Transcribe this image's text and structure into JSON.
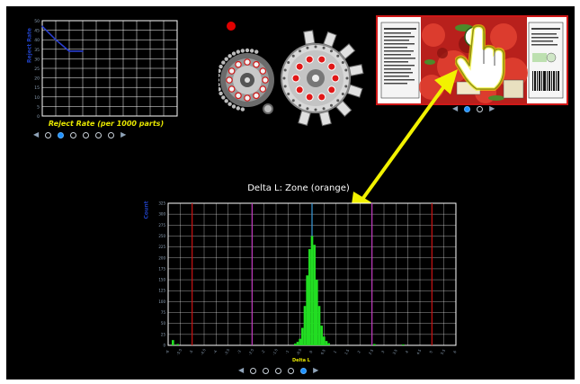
{
  "reject_panel": {
    "ylabel": "Reject Rate",
    "xlabel": "Reject Rate (per 1000 parts)",
    "pager": {
      "count": 6,
      "active": 1
    }
  },
  "label_panel": {
    "pager": {
      "count": 2,
      "active": 0
    }
  },
  "histogram_panel": {
    "title": "Delta L: Zone (orange)",
    "ylabel": "Count",
    "xlabel": "Delta L",
    "pager": {
      "count": 5,
      "active": 4
    }
  },
  "colors": {
    "background": "#000000",
    "grid": "#ffffff",
    "histogram": "#22dd22",
    "arrow": "#f2f200",
    "axis_label": "#1f3fbf",
    "pager_active": "#1e90ff",
    "red_marker": "#e00000"
  },
  "icons": [
    "status-light-icon",
    "rotary-machine-icon",
    "hand-cursor-icon",
    "double-arrow-icon"
  ],
  "chart_data": [
    {
      "type": "line",
      "title": "",
      "xlabel": "Reject Rate (per 1000 parts)",
      "ylabel": "Reject Rate",
      "ylim": [
        0,
        50
      ],
      "yticks": [
        0,
        5,
        10,
        15,
        20,
        25,
        30,
        35,
        40,
        45,
        50
      ],
      "x": [
        0,
        1,
        2,
        3
      ],
      "xlim": [
        0,
        10
      ],
      "series": [
        {
          "values": [
            47,
            40,
            34,
            34
          ]
        }
      ],
      "grid": true
    },
    {
      "type": "bar",
      "title": "Delta L: Zone (orange)",
      "xlabel": "Delta L",
      "ylabel": "Count",
      "ylim": [
        0,
        325
      ],
      "yticks": [
        0,
        25,
        50,
        75,
        100,
        125,
        150,
        175,
        200,
        225,
        250,
        275,
        300,
        325
      ],
      "xlim": [
        -6,
        6
      ],
      "xticks": [
        -6,
        -5.5,
        -5,
        -4.5,
        -4,
        -3.5,
        -3,
        -2.5,
        -2,
        -1.5,
        -1,
        -0.5,
        0,
        0.5,
        1,
        1.5,
        2,
        2.5,
        3,
        3.5,
        4,
        4.5,
        5,
        5.5,
        6
      ],
      "bins_x": [
        -5.8,
        -5.6,
        -0.7,
        -0.6,
        -0.5,
        -0.4,
        -0.3,
        -0.2,
        -0.1,
        0,
        0.1,
        0.2,
        0.3,
        0.4,
        0.5,
        0.6,
        0.7,
        2.6,
        3.8
      ],
      "values": [
        12,
        3,
        4,
        8,
        15,
        40,
        90,
        160,
        220,
        250,
        230,
        150,
        90,
        45,
        20,
        10,
        5,
        3,
        2
      ],
      "markers": [
        {
          "x": -5,
          "color": "#cc1111"
        },
        {
          "x": -2.5,
          "color": "#c23bc2"
        },
        {
          "x": 0,
          "color": "#3a9ad9"
        },
        {
          "x": 2.5,
          "color": "#c23bc2"
        },
        {
          "x": 5,
          "color": "#cc1111"
        }
      ],
      "grid": true
    }
  ]
}
